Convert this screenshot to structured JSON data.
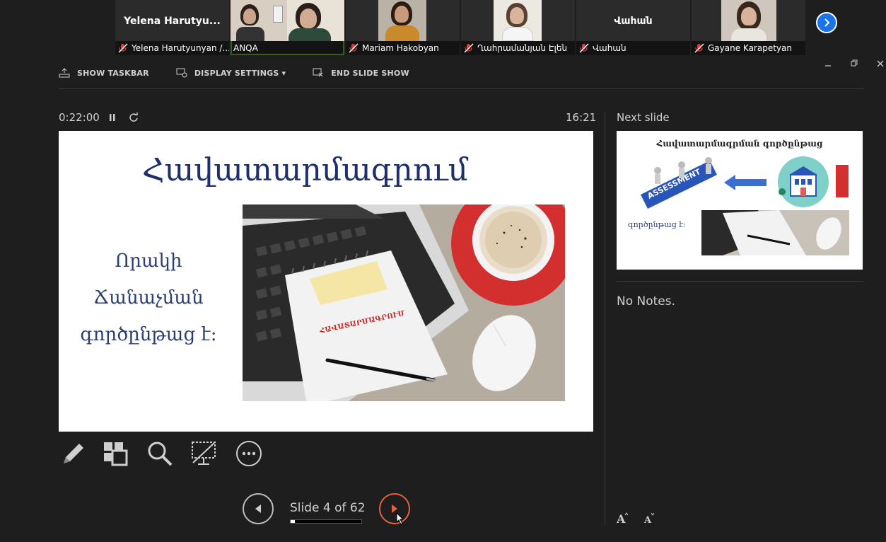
{
  "participants": [
    {
      "big_name": "Yelena  Harutyu...",
      "caption": "Yelena Harutyunyan /...",
      "video": false
    },
    {
      "big_name": "",
      "caption": "ANQA",
      "video": true,
      "active": true
    },
    {
      "big_name": "",
      "caption": "Mariam Hakobyan",
      "video": true
    },
    {
      "big_name": "",
      "caption": "Ղահրամանյան Էլեն",
      "video": true
    },
    {
      "big_name": "Վահան",
      "caption": "Վահան",
      "video": false
    },
    {
      "big_name": "",
      "caption": "Gayane Karapetyan",
      "video": true
    }
  ],
  "toolbar": {
    "show_taskbar": "SHOW TASKBAR",
    "display_settings": "DISPLAY SETTINGS ▾",
    "end_slide_show": "END SLIDE SHOW"
  },
  "timer": {
    "elapsed": "0:22:00",
    "clock": "16:21"
  },
  "current_slide": {
    "title": "Հավատարմագրում",
    "body_lines": [
      "Որակի",
      "Ճանաչման",
      "գործընթաց է:"
    ],
    "image_stamp_text": "ՀԱՎԱՏԱՐՄԱԳՐՈՒՄ"
  },
  "next_slide": {
    "label": "Next slide",
    "title": "Հավատարմագրման գործընթաց",
    "body": "գործընթաց է:",
    "assessment_text": "ASSESSMENT"
  },
  "notes": {
    "text": "No Notes."
  },
  "navigation": {
    "slide_label": "Slide 4 of 62",
    "current": 4,
    "total": 62
  },
  "colors": {
    "accent_next": "#e8603c",
    "active_speaker": "#8bc34a",
    "strip_next": "#1a73e8",
    "mute_red": "#e53935"
  }
}
